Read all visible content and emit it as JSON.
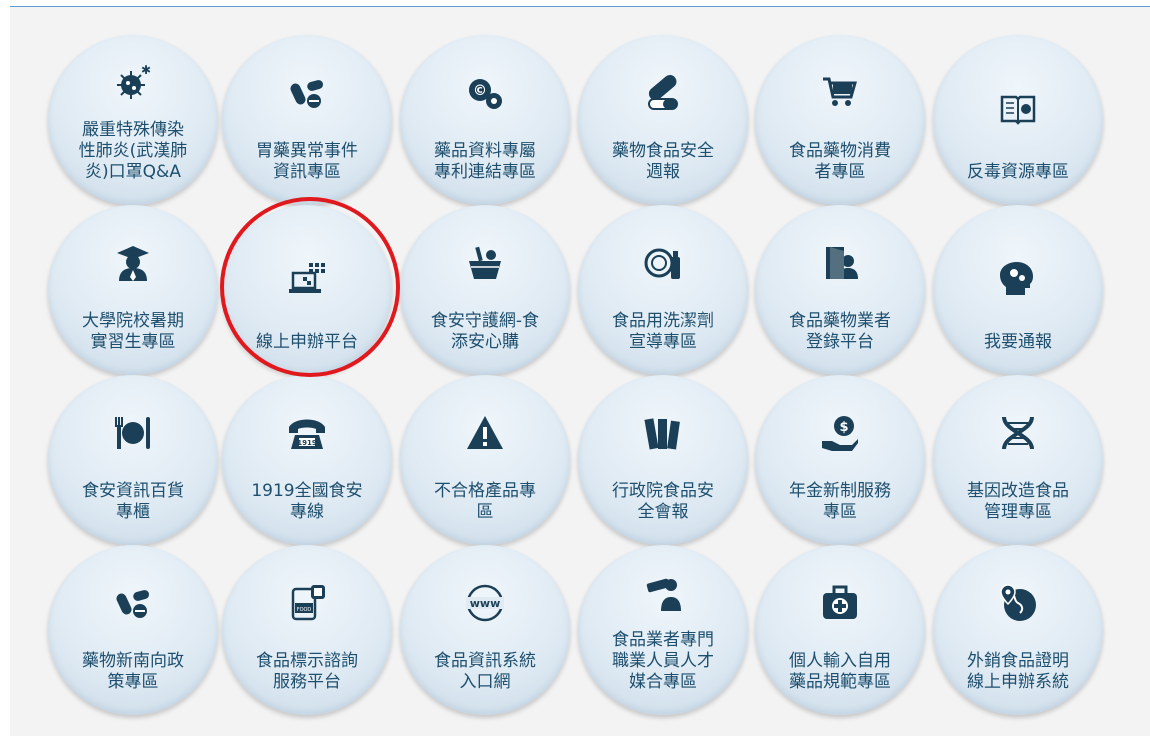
{
  "colors": {
    "icon": "#1b3f56",
    "label": "#1e4f6e",
    "highlight": "#e0191e",
    "tile_bg": "#dfeaf3",
    "frame_line": "#5b9bd5"
  },
  "tiles": [
    {
      "label": "嚴重特殊傳染\n性肺炎(武漢肺\n炎)口罩Q&A",
      "icon": "virus-icon"
    },
    {
      "label": "胃藥異常事件\n資訊專區",
      "icon": "pills-icon"
    },
    {
      "label": "藥品資料專屬\n專利連結專區",
      "icon": "copyright-pill-icon"
    },
    {
      "label": "藥物食品安全\n週報",
      "icon": "capsule-icon"
    },
    {
      "label": "食品藥物消費\n者專區",
      "icon": "shopping-cart-icon"
    },
    {
      "label": "反毒資源專區",
      "icon": "book-icon"
    },
    {
      "label": "大學院校暑期\n實習生專區",
      "icon": "graduate-icon"
    },
    {
      "label": "線上申辦平台",
      "icon": "laptop-icon"
    },
    {
      "label": "食安守護網-食\n添安心購",
      "icon": "basket-icon"
    },
    {
      "label": "食品用洗潔劑\n宣導專區",
      "icon": "dish-soap-icon"
    },
    {
      "label": "食品藥物業者\n登錄平台",
      "icon": "door-user-icon"
    },
    {
      "label": "我要通報",
      "icon": "head-gears-icon"
    },
    {
      "label": "食安資訊百貨\n專櫃",
      "icon": "fork-plate-icon"
    },
    {
      "label": "1919全國食安\n專線",
      "icon": "telephone-1919-icon"
    },
    {
      "label": "不合格產品專\n區",
      "icon": "warning-icon"
    },
    {
      "label": "行政院食品安\n全會報",
      "icon": "books-icon"
    },
    {
      "label": "年金新制服務\n專區",
      "icon": "money-hand-icon"
    },
    {
      "label": "基因改造食品\n管理專區",
      "icon": "dna-icon"
    },
    {
      "label": "藥物新南向政\n策專區",
      "icon": "pills-icon"
    },
    {
      "label": "食品標示諮詢\n服務平台",
      "icon": "food-can-icon"
    },
    {
      "label": "食品資訊系統\n入口網",
      "icon": "www-icon"
    },
    {
      "label": "食品業者專門\n職業人員人才\n媒合專區",
      "icon": "telescope-icon"
    },
    {
      "label": "個人輸入自用\n藥品規範專區",
      "icon": "first-aid-icon"
    },
    {
      "label": "外銷食品證明\n線上申辦系統",
      "icon": "globe-pin-icon"
    }
  ]
}
